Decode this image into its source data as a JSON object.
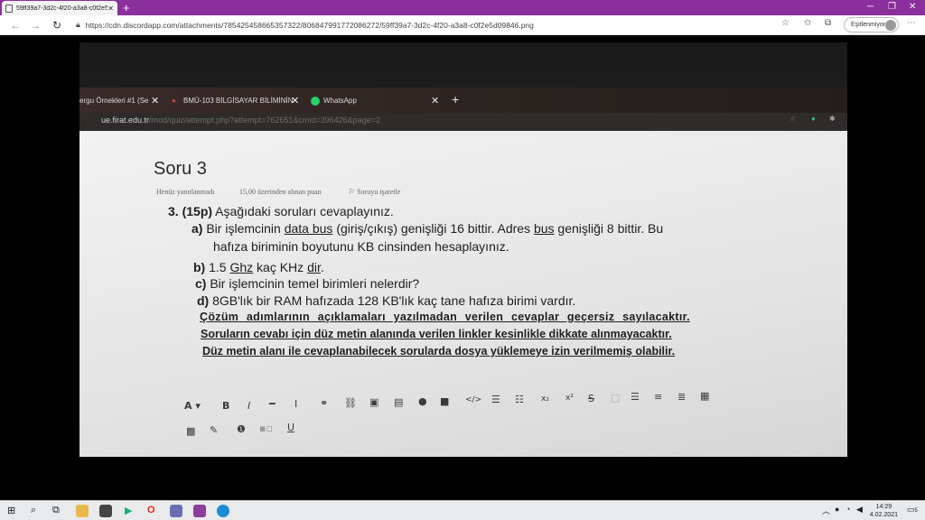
{
  "browser": {
    "tab_title": "59ff39a7-3d2c-4f20-a3a8-c0f2e5",
    "url": "https://cdn.discordapp.com/attachments/785425458665357322/806847991772086272/59ff39a7-3d2c-4f20-a3a8-c0f2e5d09846.png",
    "sync_label": "Eşitlenmiyor"
  },
  "photo": {
    "tabs": [
      "ergu Örnekleri #1 (Se",
      "BMÜ-103 BİLGİSAYAR BİLİMİNİN",
      "WhatsApp"
    ],
    "address": "ue.firat.edu.tr",
    "address_path": "/mod/quiz/attempt.php?attempt=762651&cmid=396426&page=2",
    "question_title": "Soru 3",
    "meta": [
      "Henüz yanıtlanmadı",
      "15,00 üzerinden alınan puan",
      "Soruyu işaretle"
    ],
    "q_number": "3.",
    "q_points": "(15p)",
    "q_intro": "Aşağıdaki soruları cevaplayınız.",
    "a_label": "a)",
    "a_line1_p1": "Bir işlemcinin",
    "a_line1_u1": "data bus",
    "a_line1_p2": "(giriş/çıkış) genişliği 16 bittir. Adres",
    "a_line1_u2": "bus",
    "a_line1_p3": "genişliği 8 bittir. Bu",
    "a_line2": "hafıza biriminin boyutunu KB cinsinden hesaplayınız.",
    "b_label": "b)",
    "b_p1": "1.5",
    "b_u1": "Ghz",
    "b_p2": "kaç KHz",
    "b_u2": "dir",
    "b_p3": ".",
    "c_label": "c)",
    "c_text": "Bir işlemcinin temel birimleri nelerdir?",
    "d_label": "d)",
    "d_text": "8GB'lık bir RAM hafızada 128 KB'lık kaç tane hafıza birimi vardır.",
    "warn1": "Çözüm adımlarının açıklamaları yazılmadan verilen cevaplar geçersiz sayılacaktır.",
    "warn2": "Soruların cevabı için düz metin alanında verilen linkler kesinlikle dikkate alınmayacaktır.",
    "warn3": "Düz metin alanı ile cevaplanabilecek sorularda dosya yüklemeye izin verilmemiş olabilir.",
    "editor_font_label": "A",
    "editor_bold": "B",
    "editor_italic": "I",
    "editor_underline": "U"
  },
  "taskbar": {
    "time": "14:29",
    "date": "4.02.2021",
    "notif_count": "5"
  }
}
